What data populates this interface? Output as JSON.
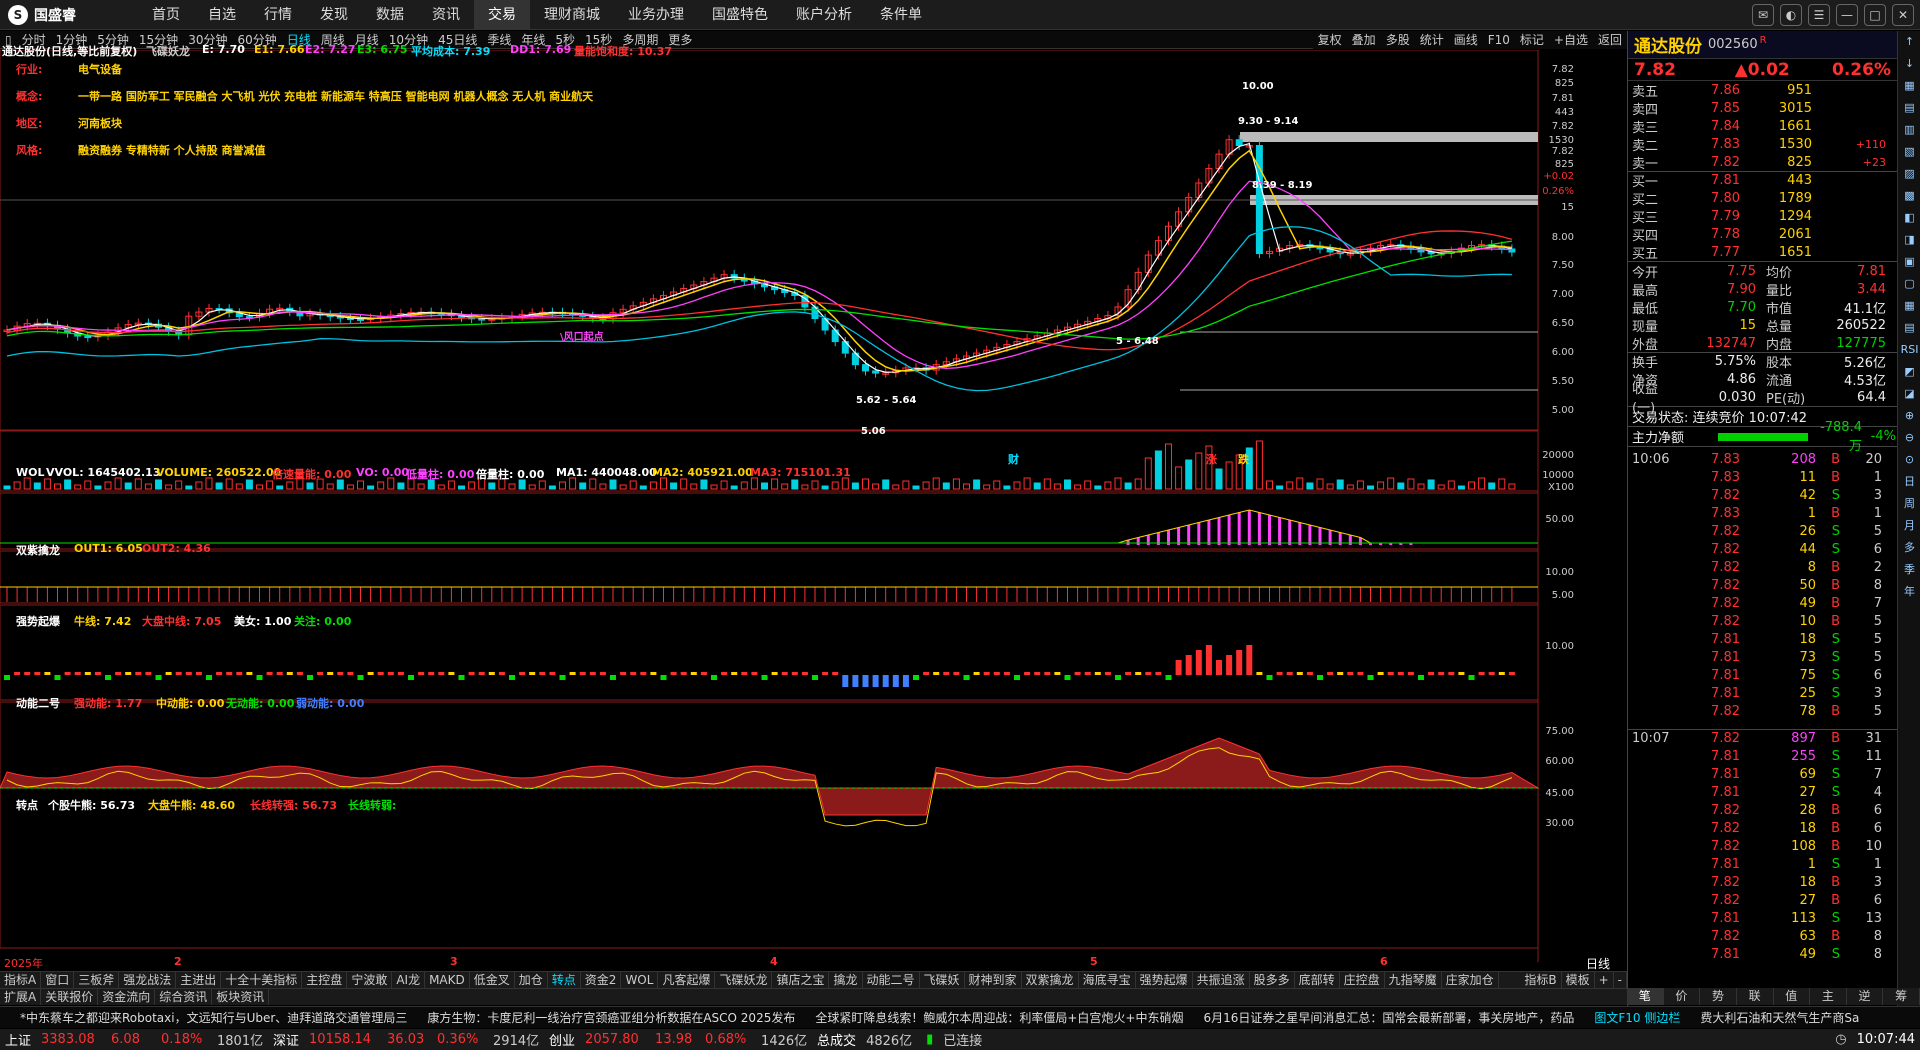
{
  "app": {
    "brand": "国盛睿"
  },
  "menu": [
    "首页",
    "自选",
    "行情",
    "发现",
    "数据",
    "资讯",
    "交易",
    "理财商城",
    "业务办理",
    "国盛特色",
    "账户分析",
    "条件单"
  ],
  "periods": [
    "分时",
    "1分钟",
    "5分钟",
    "15分钟",
    "30分钟",
    "60分钟",
    "日线",
    "周线",
    "月线",
    "10分钟",
    "45日线",
    "季线",
    "年线",
    "5秒",
    "15秒",
    "多周期",
    "更多"
  ],
  "period_tools": [
    "复权",
    "叠加",
    "多股",
    "统计",
    "画线",
    "F10",
    "标记",
    "+自选",
    "返回"
  ],
  "main_indicator": {
    "title": "通达股份(日线,等比前复权)",
    "name": "飞碟妖龙",
    "e": "E: 7.70",
    "e1": "E1: 7.66",
    "e2": "E2: 7.27",
    "e3": "E3: 6.75",
    "avg": "平均成本: 7.39",
    "dd1": "DD1: 7.69",
    "sat": "量能饱和度: 10.37"
  },
  "info": {
    "industry_k": "行业:",
    "industry_v": "电气设备",
    "concept_k": "概念:",
    "concept_v": "一带一路 国防军工 军民融合 大飞机 光伏 充电桩 新能源车 特高压 智能电网 机器人概念 无人机 商业航天",
    "region_k": "地区:",
    "region_v": "河南板块",
    "style_k": "风格:",
    "style_v": "融资融券 专精特新 个人持股 商誉减值"
  },
  "annotations": {
    "hi": "10.00",
    "r1": "9.30 - 9.14",
    "r2": "8.39 - 8.19",
    "low1": "5.62 - 5.64",
    "low2": "5.06",
    "pt": "5 - 6.48",
    "wind": "\\风口起点",
    "cai": "财",
    "zhang": "涨",
    "die": "跌"
  },
  "price_axis": [
    "7.82",
    "825",
    "7.81",
    "443",
    "7.82",
    "1530",
    "7.82",
    "825",
    "+0.02",
    "0.26%",
    "15",
    "8.00",
    "7.50",
    "7.00",
    "6.50",
    "6.00",
    "5.50",
    "5.00"
  ],
  "vol_indicator": {
    "name": "WOL",
    "vvol": "VVOL: 1645402.13",
    "volume": "VOLUME: 260522.00",
    "bei": "倍速量能: 0.00",
    "vo": "VO: 0.00",
    "di": "低量柱: 0.00",
    "bl": "倍量柱: 0.00",
    "ma1": "MA1: 440048.00",
    "ma2": "MA2: 405921.00",
    "ma3": "MA3: 715101.31",
    "ax": [
      "20000",
      "10000",
      "X100"
    ]
  },
  "ind2": {
    "name": "双紫擒龙",
    "o1": "OUT1: 6.05",
    "o2": "OUT2: 4.36",
    "ax": [
      "50.00"
    ]
  },
  "ind3": {
    "name": "强势起爆",
    "niu": "牛线: 7.42",
    "dp": "大盘中线: 7.05",
    "mn": "美女: 1.00",
    "gz": "关注: 0.00",
    "ax": [
      "10.00",
      "5.00"
    ]
  },
  "ind4": {
    "name": "动能二号",
    "s": "强动能: 1.77",
    "m": "中动能: 0.00",
    "n": "无动能: 0.00",
    "w": "弱动能: 0.00",
    "ax": [
      "10.00"
    ]
  },
  "ind5": {
    "name": "转点",
    "g": "个股牛熊: 56.73",
    "d": "大盘牛熊: 48.60",
    "c": "长线转强: 56.73",
    "l": "长线转弱:",
    "ax": [
      "75.00",
      "60.00",
      "45.00",
      "30.00"
    ]
  },
  "date_axis": {
    "year": "2025年",
    "m2": "2",
    "m3": "3",
    "m4": "4",
    "m5": "5",
    "m6": "6",
    "label": "日线"
  },
  "stock": {
    "name": "通达股份",
    "code": "002560",
    "flag": "R",
    "price": "7.82",
    "change": "▲0.02",
    "pct": "0.26%"
  },
  "book": [
    {
      "l": "卖五",
      "p": "7.86",
      "v": "951",
      "c": ""
    },
    {
      "l": "卖四",
      "p": "7.85",
      "v": "3015",
      "c": ""
    },
    {
      "l": "卖三",
      "p": "7.84",
      "v": "1661",
      "c": ""
    },
    {
      "l": "卖二",
      "p": "7.83",
      "v": "1530",
      "c": "+110"
    },
    {
      "l": "卖一",
      "p": "7.82",
      "v": "825",
      "c": "+23"
    },
    {
      "l": "买一",
      "p": "7.81",
      "v": "443",
      "c": ""
    },
    {
      "l": "买二",
      "p": "7.80",
      "v": "1789",
      "c": ""
    },
    {
      "l": "买三",
      "p": "7.79",
      "v": "1294",
      "c": ""
    },
    {
      "l": "买四",
      "p": "7.78",
      "v": "2061",
      "c": ""
    },
    {
      "l": "买五",
      "p": "7.77",
      "v": "1651",
      "c": ""
    }
  ],
  "stats": [
    {
      "k": "今开",
      "v": "7.75",
      "k2": "均价",
      "v2": "7.81"
    },
    {
      "k": "最高",
      "v": "7.90",
      "k2": "量比",
      "v2": "3.44"
    },
    {
      "k": "最低",
      "v": "7.70",
      "k2": "市值",
      "v2": "41.1亿"
    },
    {
      "k": "现量",
      "v": "15",
      "k2": "总量",
      "v2": "260522"
    },
    {
      "k": "外盘",
      "v": "132747",
      "k2": "内盘",
      "v2": "127775"
    },
    {
      "k": "换手",
      "v": "5.75%",
      "k2": "股本",
      "v2": "5.26亿"
    },
    {
      "k": "净资",
      "v": "4.86",
      "k2": "流通",
      "v2": "4.53亿"
    },
    {
      "k": "收益(一)",
      "v": "0.030",
      "k2": "PE(动)",
      "v2": "64.4"
    }
  ],
  "trade_status": "交易状态: 连续竞价 10:07:42",
  "main_flow": {
    "label": "主力净额",
    "value": "-788.4万",
    "pct": "-4%"
  },
  "ticks": [
    {
      "t": "10:06",
      "p": "7.83",
      "v": "208",
      "s": "B",
      "n": "20"
    },
    {
      "t": "",
      "p": "7.83",
      "v": "11",
      "s": "B",
      "n": "1"
    },
    {
      "t": "",
      "p": "7.82",
      "v": "42",
      "s": "S",
      "n": "3"
    },
    {
      "t": "",
      "p": "7.83",
      "v": "1",
      "s": "B",
      "n": "1"
    },
    {
      "t": "",
      "p": "7.82",
      "v": "26",
      "s": "S",
      "n": "5"
    },
    {
      "t": "",
      "p": "7.82",
      "v": "44",
      "s": "S",
      "n": "6"
    },
    {
      "t": "",
      "p": "7.82",
      "v": "8",
      "s": "B",
      "n": "2"
    },
    {
      "t": "",
      "p": "7.82",
      "v": "50",
      "s": "B",
      "n": "8"
    },
    {
      "t": "",
      "p": "7.82",
      "v": "49",
      "s": "B",
      "n": "7"
    },
    {
      "t": "",
      "p": "7.82",
      "v": "10",
      "s": "B",
      "n": "5"
    },
    {
      "t": "",
      "p": "7.81",
      "v": "18",
      "s": "S",
      "n": "5"
    },
    {
      "t": "",
      "p": "7.81",
      "v": "73",
      "s": "S",
      "n": "5"
    },
    {
      "t": "",
      "p": "7.81",
      "v": "75",
      "s": "S",
      "n": "6"
    },
    {
      "t": "",
      "p": "7.81",
      "v": "25",
      "s": "S",
      "n": "3"
    },
    {
      "t": "",
      "p": "7.82",
      "v": "78",
      "s": "B",
      "n": "5"
    },
    {
      "t": "10:07",
      "p": "7.82",
      "v": "897",
      "s": "B",
      "n": "31"
    },
    {
      "t": "",
      "p": "7.81",
      "v": "255",
      "s": "S",
      "n": "11"
    },
    {
      "t": "",
      "p": "7.81",
      "v": "69",
      "s": "S",
      "n": "7"
    },
    {
      "t": "",
      "p": "7.81",
      "v": "27",
      "s": "S",
      "n": "4"
    },
    {
      "t": "",
      "p": "7.82",
      "v": "28",
      "s": "B",
      "n": "6"
    },
    {
      "t": "",
      "p": "7.82",
      "v": "18",
      "s": "B",
      "n": "6"
    },
    {
      "t": "",
      "p": "7.82",
      "v": "108",
      "s": "B",
      "n": "10"
    },
    {
      "t": "",
      "p": "7.81",
      "v": "1",
      "s": "S",
      "n": "1"
    },
    {
      "t": "",
      "p": "7.82",
      "v": "18",
      "s": "B",
      "n": "3"
    },
    {
      "t": "",
      "p": "7.82",
      "v": "27",
      "s": "B",
      "n": "6"
    },
    {
      "t": "",
      "p": "7.81",
      "v": "113",
      "s": "S",
      "n": "13"
    },
    {
      "t": "",
      "p": "7.82",
      "v": "63",
      "s": "B",
      "n": "8"
    },
    {
      "t": "",
      "p": "7.81",
      "v": "49",
      "s": "S",
      "n": "8"
    }
  ],
  "side_icons": [
    "日",
    "周",
    "月",
    "多",
    "季",
    "年"
  ],
  "tabs1": [
    "指标A",
    "窗口",
    "三板斧",
    "强龙战法",
    "主进出",
    "十全十美指标",
    "主控盘",
    "宁波敢",
    "AI龙",
    "MAKD",
    "低金叉",
    "加仓",
    "转点",
    "资金2",
    "WOL",
    "凡客起爆",
    "飞碟妖龙",
    "镇店之宝",
    "擒龙",
    "动能二号",
    "飞碟妖",
    "财神到家",
    "双紫擒龙",
    "海底寻宝",
    "强势起爆",
    "共振追涨",
    "股多多",
    "底部转",
    "庄控盘",
    "九指琴魔",
    "庄家加仓"
  ],
  "tabs1_right": [
    "指标B",
    "模板",
    "+",
    "-"
  ],
  "tabs2": [
    "扩展A",
    "关联报价",
    "资金流向",
    "综合资讯",
    "板块资讯"
  ],
  "ptabs": [
    "笔",
    "价",
    "势",
    "联",
    "值",
    "主",
    "逆",
    "筹"
  ],
  "news": [
    "*中东蔡车之都迎来Robotaxi，文远知行与Uber、迪拜道路交通管理局三",
    "康方生物：卡度尼利一线治疗宫颈癌亚组分析数据在ASCO 2025发布",
    "全球紧盯降息线索！鲍威尔本周迎战：利率僵局+白宫炮火+中东硝烟",
    "6月16日证券之星早间消息汇总：国常会最新部署，事关房地产，药品",
    "图文F10 侧边栏",
    "费大利石油和天然气生产商Sa"
  ],
  "statusbar": {
    "sh": "上证",
    "sh_v": "3383.08",
    "sh_c": "6.08",
    "sh_p": "0.18%",
    "sh_a": "1801亿",
    "sz": "深证",
    "sz_v": "10158.14",
    "sz_c": "36.03",
    "sz_p": "0.36%",
    "sz_a": "2914亿",
    "cy": "创业",
    "cy_v": "2057.80",
    "cy_c": "13.98",
    "cy_p": "0.68%",
    "cy_a": "1426亿",
    "tot": "总成交",
    "tot_v": "4826亿",
    "conn": "已连接",
    "time": "10:07:44"
  }
}
